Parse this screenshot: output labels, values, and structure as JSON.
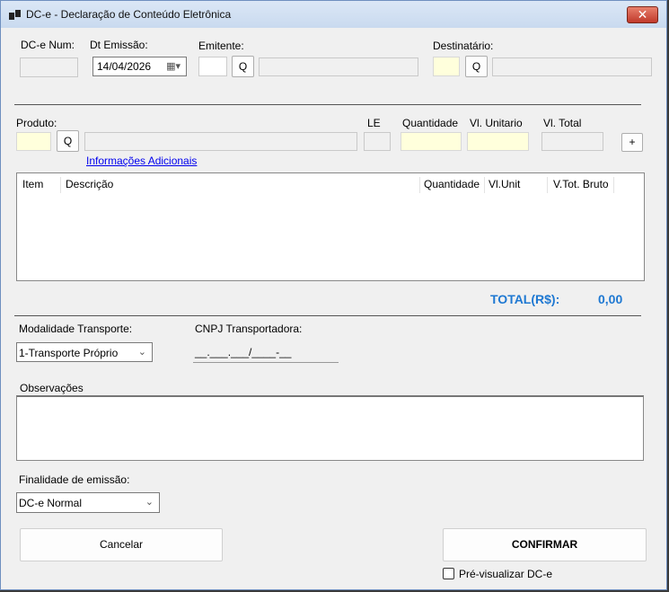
{
  "window": {
    "title": "DC-e - Declaração de Conteúdo Eletrônica",
    "close_label": "✕"
  },
  "header": {
    "dce_num_label": "DC-e Num:",
    "dce_num_value": "",
    "dt_emissao_label": "Dt Emissão:",
    "dt_emissao_value": "14/04/2026",
    "emitente_label": "Emitente:",
    "destinatario_label": "Destinatário:",
    "search_label": "Q"
  },
  "product": {
    "produto_label": "Produto:",
    "le_label": "LE",
    "quantidade_label": "Quantidade",
    "vl_unitario_label": "Vl. Unitario",
    "vl_total_label": "Vl. Total",
    "add_label": "+",
    "info_link": "Informações Adicionais"
  },
  "items_table": {
    "columns": [
      "Item",
      "Descrição",
      "Quantidade",
      "Vl.Unit",
      "V.Tot. Bruto"
    ],
    "rows": []
  },
  "totals": {
    "label": "TOTAL(R$):",
    "value": "0,00"
  },
  "transport": {
    "modalidade_label": "Modalidade Transporte:",
    "modalidade_value": "1-Transporte Próprio",
    "cnpj_label": "CNPJ Transportadora:",
    "cnpj_mask": "__.___.___/____-__"
  },
  "observacoes_label": "Observações",
  "finalidade": {
    "label": "Finalidade de emissão:",
    "value": "DC-e Normal"
  },
  "buttons": {
    "cancel": "Cancelar",
    "confirm": "CONFIRMAR"
  },
  "preview_label": "Pré-visualizar DC-e",
  "colors": {
    "total_blue": "#1e78d2",
    "required_yellow": "#ffffdc"
  }
}
